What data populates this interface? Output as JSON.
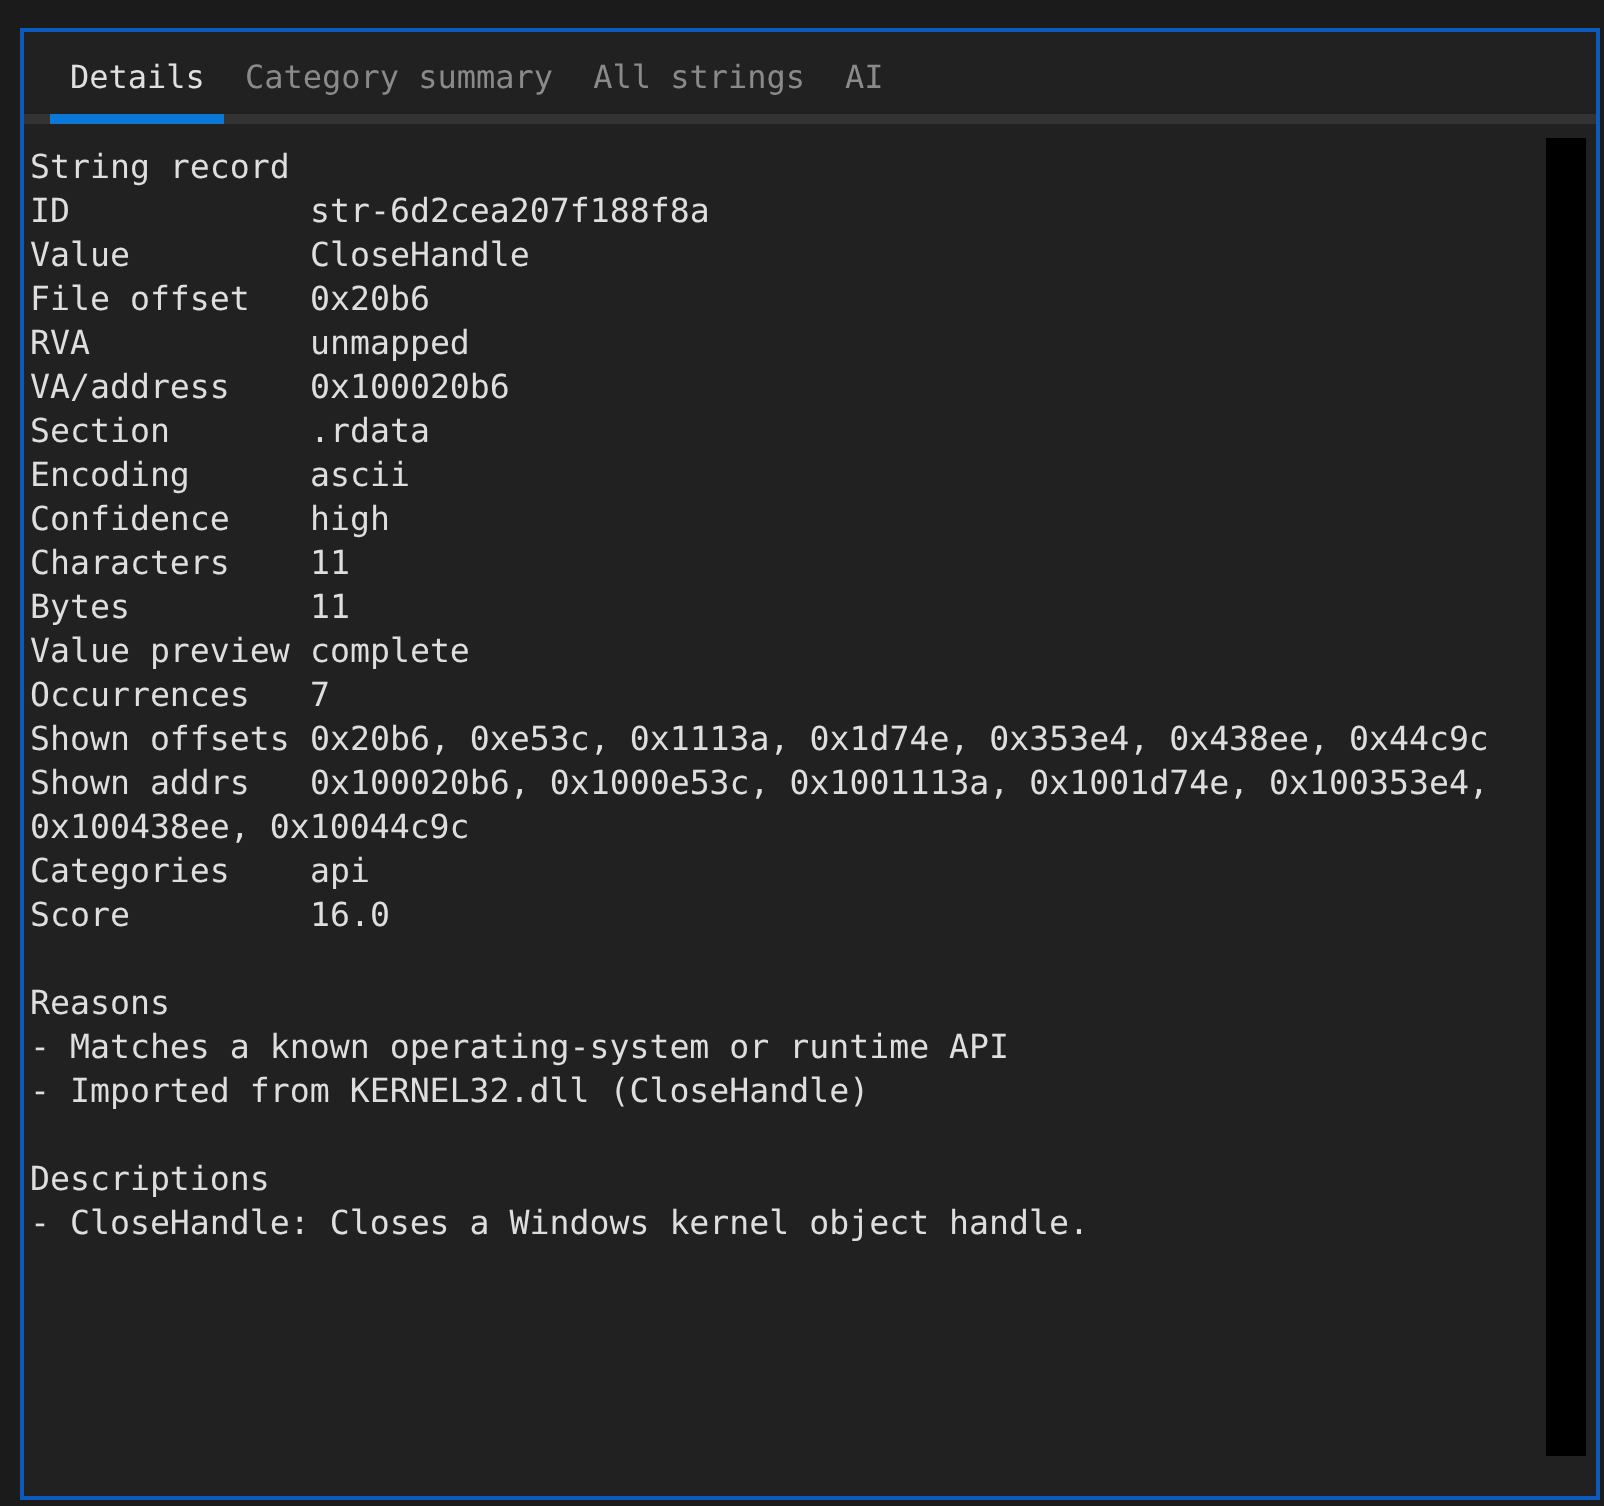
{
  "tabs": [
    {
      "label": "Details",
      "selected": true
    },
    {
      "label": "Category summary",
      "selected": false
    },
    {
      "label": "All strings",
      "selected": false
    },
    {
      "label": "AI",
      "selected": false
    }
  ],
  "record": {
    "title": "String record",
    "fields": [
      {
        "label": "ID",
        "value": "str-6d2cea207f188f8a"
      },
      {
        "label": "Value",
        "value": "CloseHandle"
      },
      {
        "label": "File offset",
        "value": "0x20b6"
      },
      {
        "label": "RVA",
        "value": "unmapped"
      },
      {
        "label": "VA/address",
        "value": "0x100020b6"
      },
      {
        "label": "Section",
        "value": ".rdata"
      },
      {
        "label": "Encoding",
        "value": "ascii"
      },
      {
        "label": "Confidence",
        "value": "high"
      },
      {
        "label": "Characters",
        "value": "11"
      },
      {
        "label": "Bytes",
        "value": "11"
      },
      {
        "label": "Value preview",
        "value": "complete"
      },
      {
        "label": "Occurrences",
        "value": "7"
      },
      {
        "label": "Shown offsets",
        "value": "0x20b6, 0xe53c, 0x1113a, 0x1d74e, 0x353e4, 0x438ee, 0x44c9c"
      },
      {
        "label": "Shown addrs",
        "value": "0x100020b6, 0x1000e53c, 0x1001113a, 0x1001d74e, 0x100353e4, 0x100438ee, 0x10044c9c"
      },
      {
        "label": "Categories",
        "value": "api"
      },
      {
        "label": "Score",
        "value": "16.0"
      }
    ]
  },
  "sections": [
    {
      "title": "Reasons",
      "items": [
        "- Matches a known operating-system or runtime API",
        "- Imported from KERNEL32.dll (CloseHandle)"
      ]
    },
    {
      "title": "Descriptions",
      "items": [
        "- CloseHandle: Closes a Windows kernel object handle."
      ]
    }
  ]
}
